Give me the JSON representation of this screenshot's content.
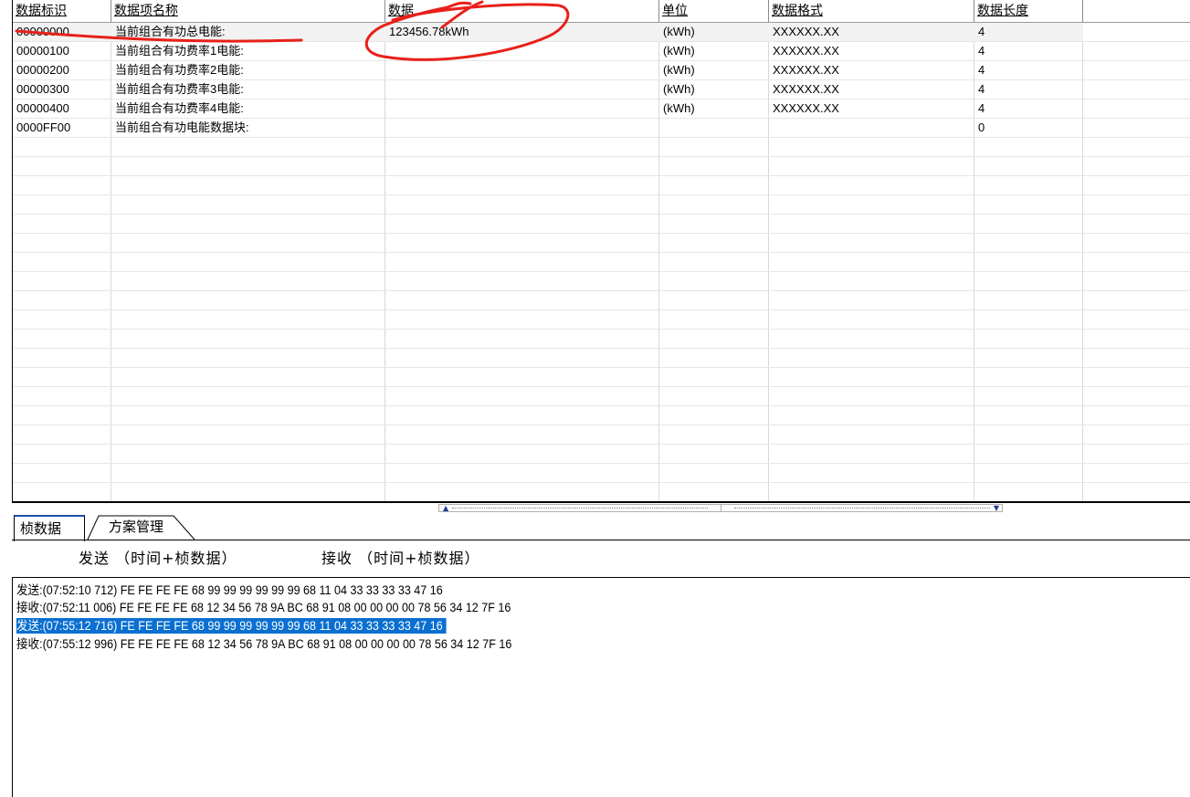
{
  "grid": {
    "columns": [
      "数据标识",
      "数据项名称",
      "数据",
      "单位",
      "数据格式",
      "数据长度"
    ],
    "rows": [
      {
        "id": "00000000",
        "name": "当前组合有功总电能:",
        "data": "123456.78kWh",
        "unit": "(kWh)",
        "format": "XXXXXX.XX",
        "length": "4"
      },
      {
        "id": "00000100",
        "name": "当前组合有功费率1电能:",
        "data": "",
        "unit": "(kWh)",
        "format": "XXXXXX.XX",
        "length": "4"
      },
      {
        "id": "00000200",
        "name": "当前组合有功费率2电能:",
        "data": "",
        "unit": "(kWh)",
        "format": "XXXXXX.XX",
        "length": "4"
      },
      {
        "id": "00000300",
        "name": "当前组合有功费率3电能:",
        "data": "",
        "unit": "(kWh)",
        "format": "XXXXXX.XX",
        "length": "4"
      },
      {
        "id": "00000400",
        "name": "当前组合有功费率4电能:",
        "data": "",
        "unit": "(kWh)",
        "format": "XXXXXX.XX",
        "length": "4"
      },
      {
        "id": "0000FF00",
        "name": "当前组合有功电能数据块:",
        "data": "",
        "unit": "",
        "format": "",
        "length": "0"
      }
    ]
  },
  "tabs": [
    "桢数据",
    "方案管理"
  ],
  "frame_header": {
    "send_label": "发送 （时间+桢数据）",
    "recv_label": "接收 （时间+桢数据）"
  },
  "log": [
    {
      "text": "发送:(07:52:10 712) FE FE FE FE 68 99 99 99 99 99 99 68 11 04 33 33 33 33 47 16",
      "highlighted": false
    },
    {
      "text": "接收:(07:52:11 006) FE FE FE FE 68 12 34 56 78 9A BC 68 91 08 00 00 00 00 78 56 34 12 7F 16",
      "highlighted": false
    },
    {
      "text": "发送:(07:55:12 716) FE FE FE FE 68 99 99 99 99 99 99 68 11 04 33 33 33 33 47 16",
      "highlighted": true
    },
    {
      "text": "接收:(07:55:12 996) FE FE FE FE 68 12 34 56 78 9A BC 68 91 08 00 00 00 00 78 56 34 12 7F 16",
      "highlighted": false
    }
  ],
  "colors": {
    "highlight": "#0a6fd0",
    "annotation": "#e8201a",
    "tab_accent": "#1d4fa8"
  }
}
